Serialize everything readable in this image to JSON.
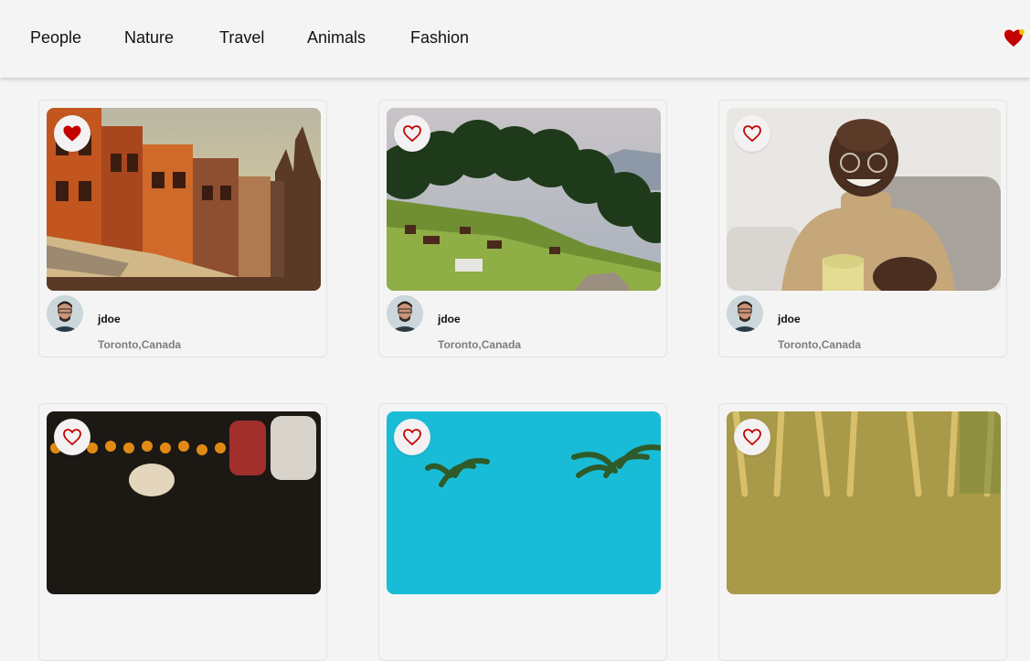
{
  "nav": {
    "items": [
      "People",
      "Nature",
      "Travel",
      "Animals",
      "Fashion"
    ],
    "favorites_icon": "heart-icon"
  },
  "colors": {
    "background": "#f4f4f4",
    "heart_red": "#c40000",
    "accent_yellow": "#f2c500"
  },
  "cards": [
    {
      "user": "jdoe",
      "location": "Toronto,Canada",
      "liked": true,
      "photo": "city-buildings"
    },
    {
      "user": "jdoe",
      "location": "Toronto,Canada",
      "liked": false,
      "photo": "horses-on-hill"
    },
    {
      "user": "jdoe",
      "location": "Toronto,Canada",
      "liked": false,
      "photo": "man-with-cup"
    },
    {
      "user": "",
      "location": "",
      "liked": false,
      "photo": "dog-in-park"
    },
    {
      "user": "",
      "location": "",
      "liked": false,
      "photo": "palm-trees"
    },
    {
      "user": "",
      "location": "",
      "liked": false,
      "photo": "wheat-field"
    }
  ]
}
